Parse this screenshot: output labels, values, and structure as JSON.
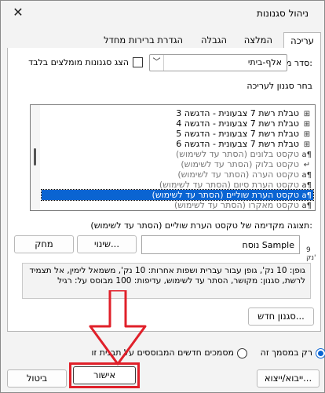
{
  "window": {
    "title": "ניהול סגנונות",
    "close_icon": "close-icon"
  },
  "tabs": [
    {
      "label": "עריכה",
      "active": true
    },
    {
      "label": "המלצה",
      "active": false
    },
    {
      "label": "הגבלה",
      "active": false
    },
    {
      "label": "הגדרת ברירות מחדל",
      "active": false
    }
  ],
  "sort": {
    "label": "סדר מיון:",
    "value": "אלף-ביתי"
  },
  "recommended_only": {
    "label": "הצג סגנונות מומלצים בלבד",
    "checked": false
  },
  "choose_label": "בחר סגנון לעריכה",
  "style_list": [
    {
      "icon": "table-icon",
      "text": "טבלת רשת 7 צבעונית - הדגשה 3",
      "dim": false,
      "selected": false
    },
    {
      "icon": "table-icon",
      "text": "טבלת רשת 7 צבעונית - הדגשה 4",
      "dim": false,
      "selected": false
    },
    {
      "icon": "table-icon",
      "text": "טבלת רשת 7 צבעונית - הדגשה 5",
      "dim": false,
      "selected": false
    },
    {
      "icon": "table-icon",
      "text": "טבלת רשת 7 צבעונית - הדגשה 6",
      "dim": false,
      "selected": false
    },
    {
      "icon": "linked-style-icon",
      "text": "טקסט בלונים  (הסתר עד לשימוש)",
      "dim": true,
      "selected": false
    },
    {
      "icon": "paragraph-style-icon",
      "text": "טקסט בלוק  (הסתר עד לשימוש)",
      "dim": true,
      "selected": false
    },
    {
      "icon": "linked-style-icon",
      "text": "טקסט הערה  (הסתר עד לשימוש)",
      "dim": true,
      "selected": false
    },
    {
      "icon": "linked-style-icon",
      "text": "טקסט הערת סיום  (הסתר עד לשימוש)",
      "dim": true,
      "selected": false
    },
    {
      "icon": "linked-style-icon",
      "text": "טקסט הערת שוליים  (הסתר עד לשימוש)",
      "dim": false,
      "selected": true
    },
    {
      "icon": "linked-style-icon",
      "text": "טקסט מאקרו  (הסתר עד לשימוש)",
      "dim": true,
      "selected": false
    }
  ],
  "preview": {
    "label": "תצוגה מקדימה של טקסט הערת שוליים  (הסתר עד לשימוש):",
    "sample": "נוסח Sample",
    "size": "9 נק'",
    "modify": "שינוי...",
    "delete": "מחק"
  },
  "description": "גופן: ‪10‬ נק', גופן עבור עברית ושפות אחרות: ‪10‬ נק', משמאל לימין, אל תצמיד לרשת, סגנון: מקושר, הסתר עד לשימוש, עדיפות: 100 מבוסס על: רגיל",
  "new_style": "סגנון חדש...",
  "scope": {
    "doc_only": "רק במסמך זה",
    "new_docs": "מסמכים חדשים המבוססים על תבנית זו",
    "selected": "doc_only"
  },
  "footer": {
    "import_export": "ייבוא/ייצוא...",
    "ok": "אישור",
    "cancel": "ביטול"
  },
  "annotation_color": "#e0202a"
}
